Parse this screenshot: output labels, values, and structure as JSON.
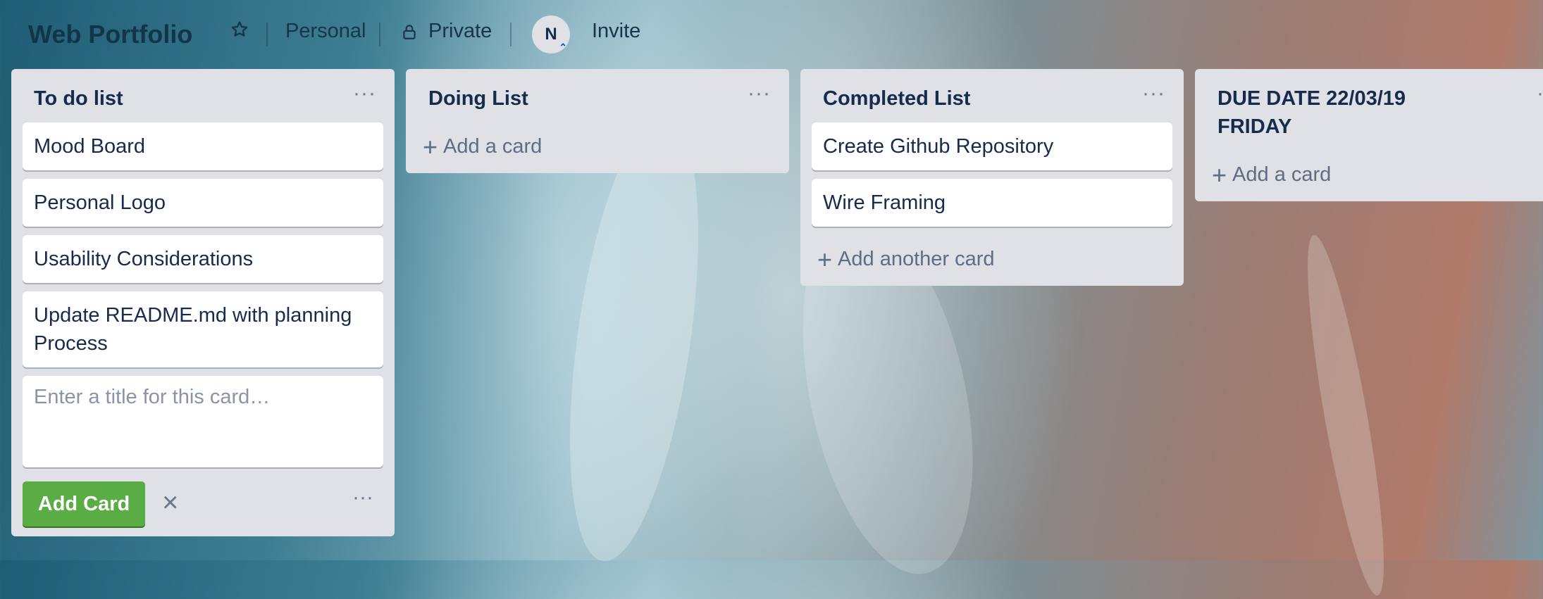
{
  "board": {
    "title": "Web Portfolio",
    "team": "Personal",
    "visibility": "Private",
    "member_initial": "N",
    "invite_label": "Invite"
  },
  "lists": [
    {
      "title": "To do list",
      "cards": [
        "Mood Board",
        "Personal Logo",
        "Usability Considerations",
        "Update README.md with planning Process"
      ],
      "composer": {
        "placeholder": "Enter a title for this card…",
        "add_label": "Add Card",
        "close_icon": "×",
        "menu": "···"
      },
      "menu": "···"
    },
    {
      "title": "Doing List",
      "cards": [],
      "add_label": "Add a card",
      "menu": "···"
    },
    {
      "title": "Completed List",
      "cards": [
        "Create Github Repository",
        "Wire Framing"
      ],
      "add_label": "Add another card",
      "menu": "···"
    },
    {
      "title": "DUE DATE 22/03/19 FRIDAY",
      "cards": [],
      "add_label": "Add a card",
      "menu": "···"
    }
  ],
  "icons": {
    "star": "star-icon",
    "lock": "lock-icon",
    "plus": "+"
  },
  "colors": {
    "list_bg": "#dfe1e6",
    "add_button": "#5aac44",
    "text": "#172b4d"
  }
}
